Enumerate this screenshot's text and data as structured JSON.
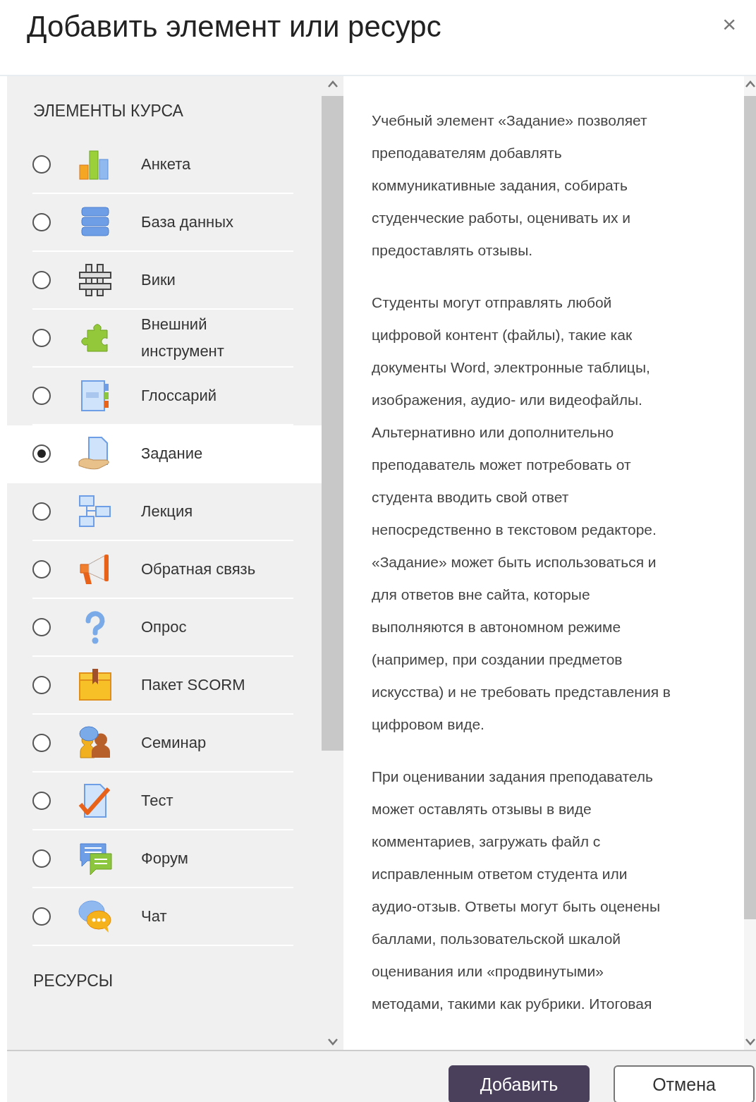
{
  "dialog": {
    "title": "Добавить элемент или ресурс",
    "close": "×"
  },
  "sections": [
    {
      "heading": "ЭЛЕМЕНТЫ КУРСА",
      "items": [
        {
          "label": "Анкета",
          "selected": false
        },
        {
          "label": "База данных",
          "selected": false
        },
        {
          "label": "Вики",
          "selected": false
        },
        {
          "label": "Внешний инструмент",
          "selected": false
        },
        {
          "label": "Глоссарий",
          "selected": false
        },
        {
          "label": "Задание",
          "selected": true
        },
        {
          "label": "Лекция",
          "selected": false
        },
        {
          "label": "Обратная связь",
          "selected": false
        },
        {
          "label": "Опрос",
          "selected": false
        },
        {
          "label": "Пакет SCORM",
          "selected": false
        },
        {
          "label": "Семинар",
          "selected": false
        },
        {
          "label": "Тест",
          "selected": false
        },
        {
          "label": "Форум",
          "selected": false
        },
        {
          "label": "Чат",
          "selected": false
        }
      ]
    },
    {
      "heading": "РЕСУРСЫ"
    }
  ],
  "description": [
    [
      "Учебный элемент «Задание» позволяет",
      "преподавателям добавлять",
      "коммуникативные задания, собирать",
      "студенческие работы, оценивать их и",
      "предоставлять отзывы."
    ],
    [
      "Студенты могут отправлять любой",
      "цифровой контент (файлы), такие как",
      "документы Word, электронные таблицы,",
      "изображения, аудио- или видеофайлы.",
      "Альтернативно или дополнительно",
      "преподаватель может потребовать от",
      "студента вводить свой ответ",
      "непосредственно в текстовом редакторе.",
      "«Задание» может быть использоваться и",
      "для ответов вне сайта, которые",
      "выполняются в автономном режиме",
      "(например, при создании предметов",
      "искусства) и не требовать представления в",
      "цифровом виде."
    ],
    [
      "При оценивании задания преподаватель",
      "может оставлять отзывы в виде",
      "комментариев, загружать файл с",
      "исправленным ответом студента или",
      "аудио-отзыв. Ответы могут быть оценены",
      "баллами, пользовательской шкалой",
      "оценивания или «продвинутыми»",
      "методами, такими как рубрики. Итоговая"
    ]
  ],
  "buttons": [
    {
      "label": "Добавить",
      "kind": "primary"
    },
    {
      "label": "Отмена",
      "kind": "secondary"
    }
  ]
}
